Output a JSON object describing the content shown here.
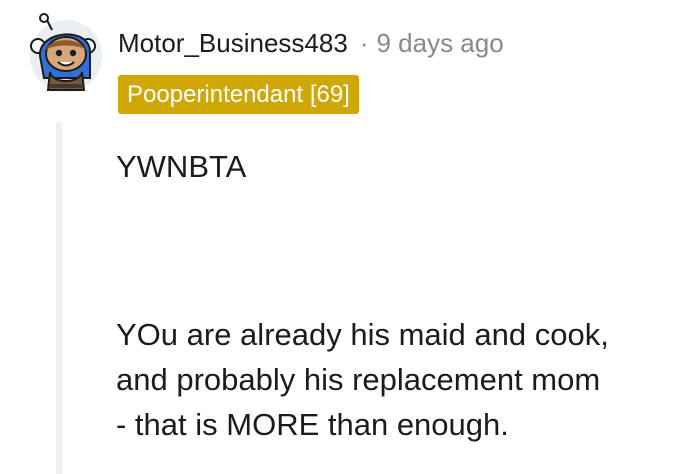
{
  "comment": {
    "username": "Motor_Business483",
    "separator": "·",
    "timestamp": "9 days ago",
    "flair": "Pooperintendant [69]",
    "paragraphs": [
      {
        "lines": [
          "YWNBTA"
        ]
      },
      {
        "lines": [
          "YOu are already his maid and cook,",
          "and probably his replacement mom",
          "- that is MORE than enough."
        ]
      }
    ]
  },
  "colors": {
    "flair_background": "#cfa807",
    "flair_text": "#ffffff",
    "username": "#1c1c1c",
    "timestamp": "#878a8c",
    "thread_line": "#eef0f2"
  },
  "icons": {
    "avatar": "snoo-avatar-icon"
  }
}
